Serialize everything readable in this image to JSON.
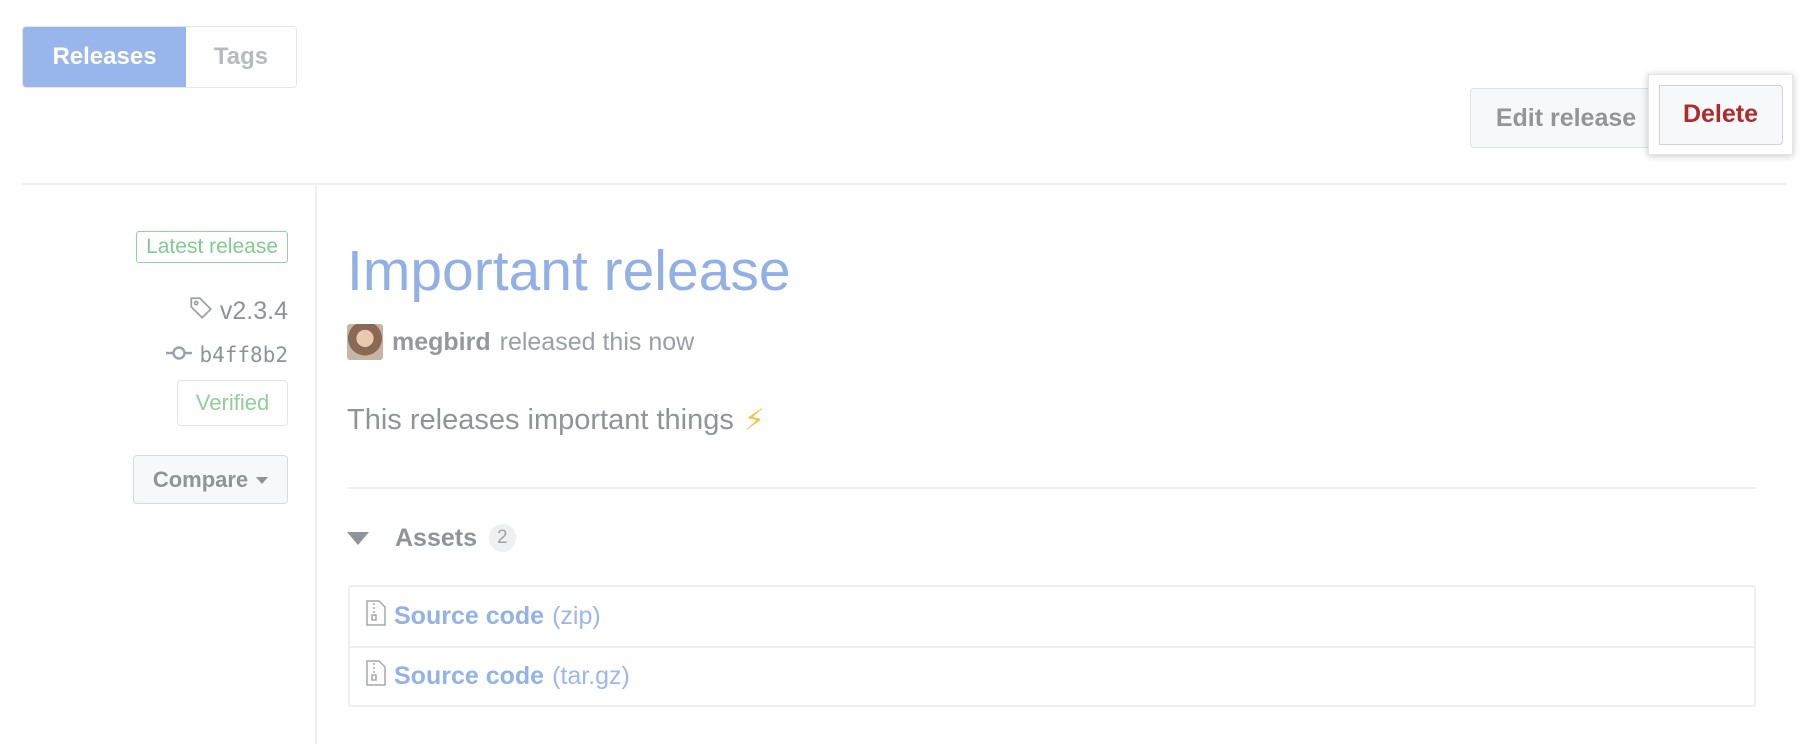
{
  "tabs": [
    {
      "label": "Releases",
      "active": true
    },
    {
      "label": "Tags",
      "active": false
    }
  ],
  "actions": {
    "edit_label": "Edit release",
    "delete_label": "Delete"
  },
  "meta": {
    "latest_badge": "Latest release",
    "tag": "v2.3.4",
    "commit": "b4ff8b2",
    "verified": "Verified",
    "compare_label": "Compare"
  },
  "release": {
    "title": "Important release",
    "author": "megbird",
    "released_text": "released this now",
    "body": "This releases important things",
    "body_emoji": "⚡"
  },
  "assets": {
    "label": "Assets",
    "count": "2",
    "items": [
      {
        "name": "Source code",
        "ext": "(zip)"
      },
      {
        "name": "Source code",
        "ext": "(tar.gz)"
      }
    ]
  },
  "colors": {
    "accent": "#98b5ec",
    "link": "#93b2e8",
    "danger": "#b02a2a",
    "success": "#7fcc90"
  }
}
